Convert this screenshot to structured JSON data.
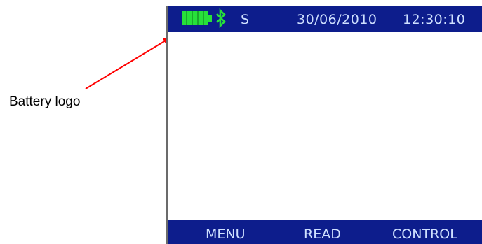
{
  "annotation": {
    "label": "Battery logo"
  },
  "status_bar": {
    "battery_icon": "battery-icon",
    "bluetooth_icon": "bluetooth-icon",
    "signal_letter": "S",
    "date": "30/06/2010",
    "time": "12:30:10"
  },
  "softkeys": {
    "menu": "MENU",
    "read": "READ",
    "control": "CONTROL"
  },
  "colors": {
    "bar_background": "#0d1d8c",
    "bar_text": "#cfe0ff",
    "battery_fill": "#27e03a",
    "bluetooth": "#27e03a",
    "arrow": "#ff0000"
  }
}
